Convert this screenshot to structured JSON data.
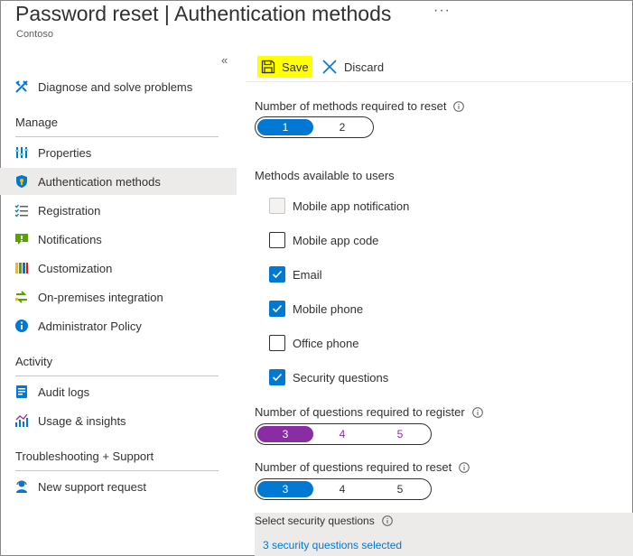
{
  "header": {
    "title_main": "Password reset",
    "title_sep": " | ",
    "title_sub": "Authentication methods",
    "more": "···",
    "org": "Contoso"
  },
  "sidebar": {
    "collapse_glyph": "«",
    "top_item": {
      "label": "Diagnose and solve problems",
      "icon": "wrench-tools-icon"
    },
    "sections": [
      {
        "title": "Manage",
        "items": [
          {
            "label": "Properties",
            "icon": "properties-icon"
          },
          {
            "label": "Authentication methods",
            "icon": "shield-icon",
            "selected": true
          },
          {
            "label": "Registration",
            "icon": "checklist-icon"
          },
          {
            "label": "Notifications",
            "icon": "notification-icon"
          },
          {
            "label": "Customization",
            "icon": "customization-icon"
          },
          {
            "label": "On-premises integration",
            "icon": "sync-icon"
          },
          {
            "label": "Administrator Policy",
            "icon": "info-icon"
          }
        ]
      },
      {
        "title": "Activity",
        "items": [
          {
            "label": "Audit logs",
            "icon": "audit-log-icon"
          },
          {
            "label": "Usage & insights",
            "icon": "insights-icon"
          }
        ]
      },
      {
        "title": "Troubleshooting + Support",
        "items": [
          {
            "label": "New support request",
            "icon": "support-person-icon"
          }
        ]
      }
    ]
  },
  "toolbar": {
    "save_label": "Save",
    "discard_label": "Discard",
    "save_highlight": "#ffff00"
  },
  "methods_required": {
    "label": "Number of methods required to reset",
    "options": [
      "1",
      "2"
    ],
    "selected": "1"
  },
  "methods_available": {
    "label": "Methods available to users",
    "items": [
      {
        "label": "Mobile app notification",
        "checked": false,
        "disabled": true
      },
      {
        "label": "Mobile app code",
        "checked": false
      },
      {
        "label": "Email",
        "checked": true
      },
      {
        "label": "Mobile phone",
        "checked": true
      },
      {
        "label": "Office phone",
        "checked": false
      },
      {
        "label": "Security questions",
        "checked": true
      }
    ]
  },
  "questions_register": {
    "label": "Number of questions required to register",
    "options": [
      "3",
      "4",
      "5"
    ],
    "selected": "3"
  },
  "questions_reset": {
    "label": "Number of questions required to reset",
    "options": [
      "3",
      "4",
      "5"
    ],
    "selected": "3"
  },
  "security_questions": {
    "label": "Select security questions",
    "link": "3 security questions selected"
  },
  "colors": {
    "accent_blue": "#0078d4",
    "accent_purple": "#8a2da5",
    "selected_nav_bg": "#edebe9"
  }
}
